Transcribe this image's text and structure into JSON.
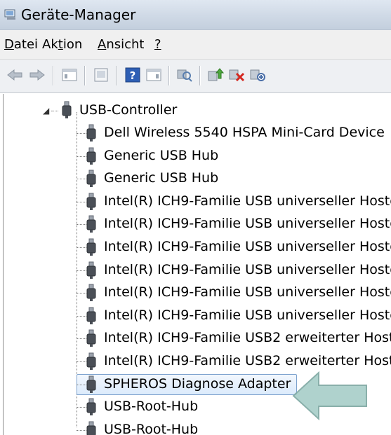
{
  "window": {
    "title": "Geräte-Manager"
  },
  "menu": {
    "items": [
      {
        "pre": "",
        "ul": "D",
        "post": "atei"
      },
      {
        "pre": "Ak",
        "ul": "t",
        "post": "ion"
      },
      {
        "pre": "",
        "ul": "A",
        "post": "nsicht"
      },
      {
        "pre": "",
        "ul": "?",
        "post": ""
      }
    ]
  },
  "toolbar": {
    "buttons": [
      "back-icon",
      "forward-icon",
      "properties-icon",
      "console-tree-icon",
      "help-icon",
      "action-pane-icon",
      "scan-hardware-icon",
      "update-driver-icon",
      "uninstall-device-icon",
      "disable-device-icon"
    ]
  },
  "tree": {
    "category": "USB-Controller",
    "devices": [
      "Dell Wireless 5540 HSPA Mini-Card Device",
      "Generic USB Hub",
      "Generic USB Hub",
      "Intel(R) ICH9-Familie USB universeller Hostc",
      "Intel(R) ICH9-Familie USB universeller Hostc",
      "Intel(R) ICH9-Familie USB universeller Hostc",
      "Intel(R) ICH9-Familie USB universeller Hostc",
      "Intel(R) ICH9-Familie USB universeller Hostc",
      "Intel(R) ICH9-Familie USB universeller Hostc",
      "Intel(R) ICH9-Familie USB2 erweiterter Hoste",
      "Intel(R) ICH9-Familie USB2 erweiterter Hoste",
      "SPHEROS Diagnose Adapter",
      "USB-Root-Hub",
      "USB-Root-Hub"
    ],
    "selected_device": "SPHEROS Diagnose Adapter"
  },
  "colors": {
    "selection_border": "#7da2ce",
    "arrow_fill": "#a9cfc9",
    "arrow_stroke": "#7fa9a3"
  }
}
